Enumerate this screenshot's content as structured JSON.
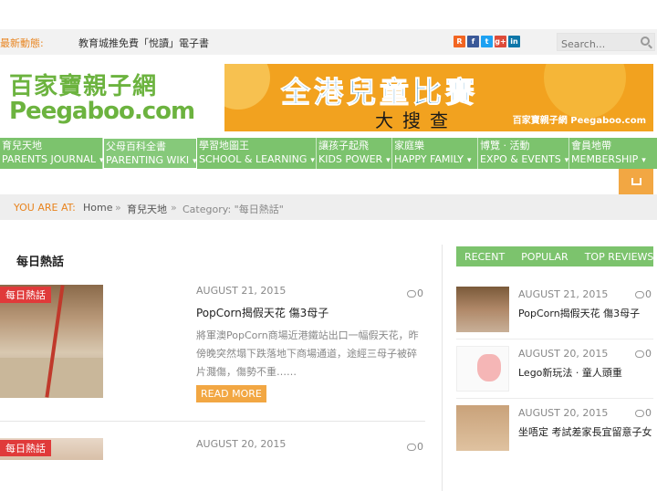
{
  "topbar": {
    "ticker_label": "最新動態:",
    "ticker_text": "教育城推免費「悅讀」電子書",
    "social": [
      {
        "name": "rss-icon",
        "glyph": "R"
      },
      {
        "name": "facebook-icon",
        "glyph": "f"
      },
      {
        "name": "twitter-icon",
        "glyph": "t"
      },
      {
        "name": "googleplus-icon",
        "glyph": "g+"
      },
      {
        "name": "linkedin-icon",
        "glyph": "in"
      }
    ],
    "search_placeholder": "Search..."
  },
  "header": {
    "logo_cn": "百家寶親子網",
    "logo_en": "Peegaboo.com",
    "banner_title": "全港兒童比賽",
    "banner_sub": "大搜查",
    "banner_logo": "百家寶親子網 Peegaboo.com"
  },
  "nav": {
    "items": [
      {
        "zh": "育兒天地",
        "en": "PARENTS JOURNAL"
      },
      {
        "zh": "父母百科全書",
        "en": "PARENTING WIKI"
      },
      {
        "zh": "學習地圖王",
        "en": "SCHOOL & LEARNING"
      },
      {
        "zh": "讓孩子起飛",
        "en": "KIDS POWER"
      },
      {
        "zh": "家庭樂",
        "en": "HAPPY FAMILY"
      },
      {
        "zh": "博覽 · 活動",
        "en": "EXPO & EVENTS"
      },
      {
        "zh": "會員地帶",
        "en": "MEMBERSHIP"
      }
    ]
  },
  "breadcrumb": {
    "label": "YOU ARE AT:",
    "home": "Home",
    "sep": "»",
    "category": "育兒天地",
    "current": "Category: \"每日熱話\""
  },
  "main": {
    "section_title": "每日熱話",
    "posts": [
      {
        "tag": "每日熱話",
        "date": "AUGUST 21, 2015",
        "comments": "0",
        "title": "PopCorn揭假天花 傷3母子",
        "excerpt": "將軍澳PopCorn商場近港鐵站出口一幅假天花，昨傍晚突然塌下跌落地下商場通道，途經三母子被碎片濺傷，傷勢不重……",
        "read_more": "READ MORE"
      },
      {
        "tag": "每日熱話",
        "date": "AUGUST 20, 2015",
        "comments": "0"
      }
    ]
  },
  "sidebar": {
    "tabs": [
      "RECENT",
      "POPULAR",
      "TOP REVIEWS"
    ],
    "items": [
      {
        "date": "AUGUST 21, 2015",
        "comments": "0",
        "title": "PopCorn揭假天花 傷3母子"
      },
      {
        "date": "AUGUST 20, 2015",
        "comments": "0",
        "title": "Lego新玩法 · 童人頭重"
      },
      {
        "date": "AUGUST 20, 2015",
        "comments": "0",
        "title": "坐唔定 考試差家長宜留意子女"
      }
    ]
  },
  "colors": {
    "accent_green": "#7cc36d",
    "accent_orange": "#f2a743",
    "tag_red": "#e03a3a",
    "ticker_orange": "#e8841f"
  }
}
